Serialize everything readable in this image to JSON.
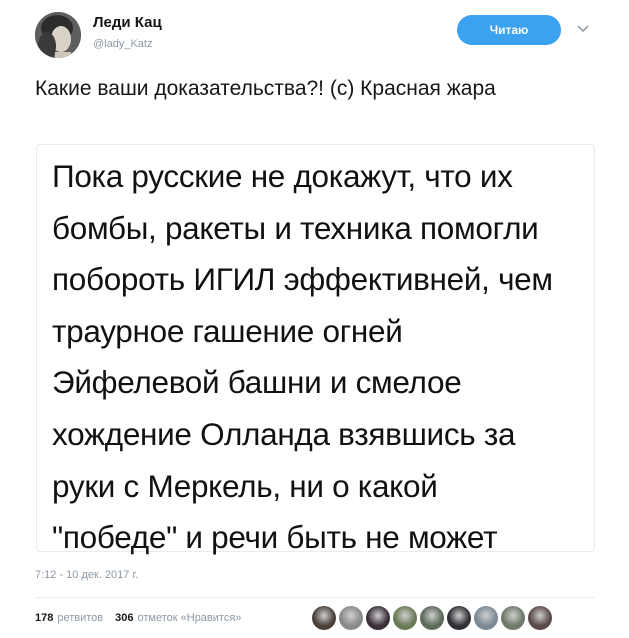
{
  "author": {
    "name": "Леди Кац",
    "handle": "@lady_Katz"
  },
  "follow_button": {
    "label": "Читаю"
  },
  "tweet": {
    "text": "Какие ваши доказательства?! (с) Красная жара"
  },
  "quoted_image": {
    "lines": [
      "Пока русские не докажут, что их",
      "бомбы, ракеты и техника помогли",
      "побороть ИГИЛ эффективней, чем",
      "траурное гашение огней",
      "Эйфелевой башни и смелое",
      "хождение Олланда взявшись за",
      "руки с Меркель, ни о какой",
      "\"победе\" и речи быть не может"
    ]
  },
  "timestamp": "7:12 - 10 дек. 2017 г.",
  "stats": {
    "retweets_count": "178",
    "retweets_label": "ретвитов",
    "likes_count": "306",
    "likes_label": "отметок «Нравится»"
  },
  "likers": [
    {
      "color": "#4a4038"
    },
    {
      "color": "#8a8a8a"
    },
    {
      "color": "#3b2f3a"
    },
    {
      "color": "#6b7b57"
    },
    {
      "color": "#5c6a5a"
    },
    {
      "color": "#2f2f35"
    },
    {
      "color": "#7b8a95"
    },
    {
      "color": "#6f7a6a"
    },
    {
      "color": "#5a4a48"
    }
  ]
}
